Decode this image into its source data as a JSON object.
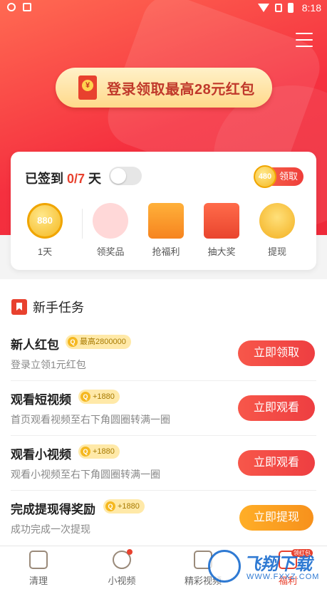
{
  "status_bar": {
    "time": "8:18",
    "icons": [
      "gear-icon",
      "a-icon",
      "wifi-icon",
      "no-sim-icon",
      "battery-icon"
    ]
  },
  "hero": {
    "menu_icon": "hamburger-menu-icon",
    "login_banner": "登录领取最高28元红包"
  },
  "checkin": {
    "title_prefix": "已签到 ",
    "progress": "0/7",
    "title_suffix": " 天",
    "toggle_on": false,
    "claim_coin": "480",
    "claim_label": "领取",
    "rewards": [
      {
        "label": "1天",
        "coin": "880",
        "icon": "coin-icon"
      },
      {
        "label": "领奖品",
        "icon": "prize-icon"
      },
      {
        "label": "抢福利",
        "icon": "gift-box-icon"
      },
      {
        "label": "抽大奖",
        "icon": "lottery-icon"
      },
      {
        "label": "提现",
        "icon": "coins-stack-icon"
      }
    ]
  },
  "tasks": {
    "title": "新手任务",
    "items": [
      {
        "name": "新人红包",
        "badge": "最高2800000",
        "desc": "登录立领1元红包",
        "button": "立即领取"
      },
      {
        "name": "观看短视频",
        "badge": "+1880",
        "desc": "首页观看视频至右下角圆圈转满一圈",
        "button": "立即观看"
      },
      {
        "name": "观看小视频",
        "badge": "+1880",
        "desc": "观看小视频至右下角圆圈转满一圈",
        "button": "立即观看"
      },
      {
        "name": "完成提现得奖励",
        "badge": "+1880",
        "desc": "成功完成一次提现",
        "button": "立即提现"
      }
    ]
  },
  "bottom_nav": [
    {
      "label": "清理",
      "icon": "broom-icon"
    },
    {
      "label": "小视频",
      "icon": "play-circle-icon"
    },
    {
      "label": "精彩视频",
      "icon": "video-house-icon"
    },
    {
      "label": "福利",
      "icon": "gift-icon",
      "badge": "领红包"
    }
  ],
  "watermark": {
    "brand": "飞翔下载",
    "url": "WWW.FXXZ.COM"
  },
  "colors": {
    "accent": "#e8412e",
    "orange": "#f7911c",
    "gold": "#f5b820"
  }
}
